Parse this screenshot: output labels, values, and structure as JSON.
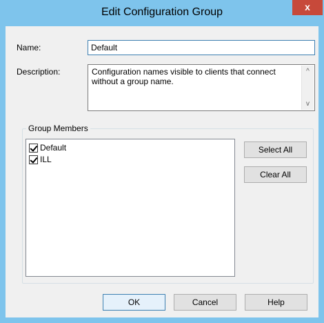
{
  "window": {
    "title": "Edit Configuration Group",
    "close_glyph": "x"
  },
  "form": {
    "name_label": "Name:",
    "name_value": "Default",
    "description_label": "Description:",
    "description_value": "Configuration names visible to clients that connect without a group name."
  },
  "group": {
    "title": "Group Members",
    "members": [
      {
        "label": "Default",
        "checked": true
      },
      {
        "label": "ILL",
        "checked": true
      }
    ],
    "select_all": "Select All",
    "clear_all": "Clear All"
  },
  "buttons": {
    "ok": "OK",
    "cancel": "Cancel",
    "help": "Help"
  },
  "scroll_glyphs": {
    "up": "^",
    "down": "v"
  }
}
